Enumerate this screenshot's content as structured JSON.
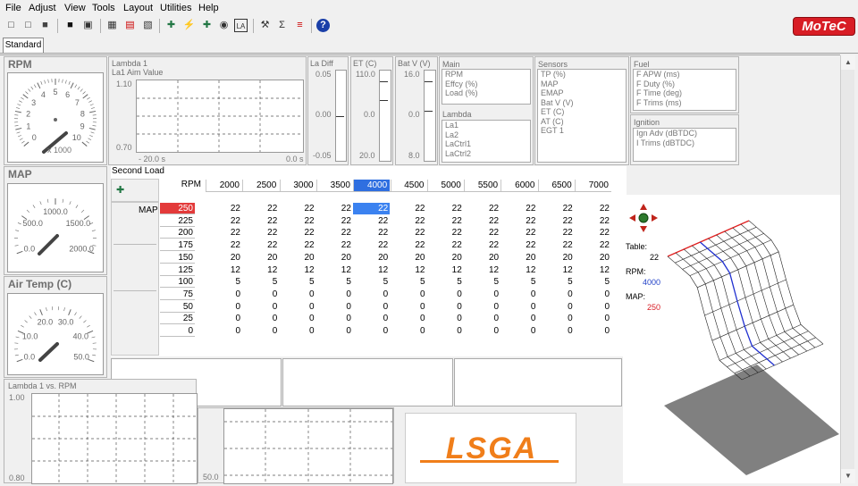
{
  "menu": [
    "File",
    "Adjust",
    "View",
    "Tools",
    "Layout",
    "Utilities",
    "Help"
  ],
  "toolbar_icons": [
    "new-icon",
    "open-icon",
    "folder-icon",
    "save-icon",
    "saveas-icon",
    "table-icon",
    "chart-icon",
    "graph-icon",
    "trend-icon",
    "tune-icon",
    "wand-icon",
    "probe-icon",
    "target-icon",
    "la-icon",
    "wrench-icon",
    "sigma-icon",
    "bars-icon",
    "help-icon"
  ],
  "brand": {
    "logo": "MoTeC",
    "company": "LSGA",
    "accent": "#d81d25",
    "orange": "#f07e1a"
  },
  "tabs": {
    "standard": "Standard"
  },
  "gauges": {
    "rpm": {
      "title": "RPM",
      "ticks": [
        "0",
        "1",
        "2",
        "3",
        "4",
        "5",
        "6",
        "7",
        "8",
        "9",
        "10"
      ],
      "unit": "x 1000",
      "value": 4.0
    },
    "map": {
      "title": "MAP",
      "ticks": [
        "0.0",
        "500.0",
        "1000.0",
        "1500.0",
        "2000.0"
      ],
      "value": 250
    },
    "air": {
      "title": "Air Temp (C)",
      "ticks": [
        "0.0",
        "10.0",
        "20.0",
        "30.0",
        "40.0",
        "50.0"
      ],
      "value": 10
    }
  },
  "lambda_panel": {
    "title1": "Lambda 1",
    "title2": "La1 Aim Value",
    "ymax": "1.10",
    "ymin": "0.70",
    "xleft": "- 20.0 s",
    "xright": "0.0 s"
  },
  "bars": [
    {
      "title": "La Diff",
      "top": "0.05",
      "mid": "0.00",
      "bot": "-0.05"
    },
    {
      "title": "ET (C)",
      "top": "110.0",
      "mid": "0.0",
      "bot": "20.0"
    },
    {
      "title": "Bat V (V)",
      "top": "16.0",
      "mid": "0.0",
      "bot": "8.0"
    }
  ],
  "lists": {
    "main": {
      "title": "Main",
      "items": [
        "RPM",
        "Effcy (%)",
        "Load (%)"
      ]
    },
    "lambda": {
      "title": "Lambda",
      "items": [
        "La1",
        "La2",
        "LaCtrl1",
        "LaCtrl2"
      ]
    },
    "sensors": {
      "title": "Sensors",
      "items": [
        "TP (%)",
        "MAP",
        "EMAP",
        "Bat V (V)",
        "ET (C)",
        "AT (C)",
        "EGT 1"
      ]
    },
    "fuel": {
      "title": "Fuel",
      "items": [
        "F APW (ms)",
        "F Duty (%)",
        "F Time (deg)",
        "F Trims (ms)"
      ]
    },
    "ignition": {
      "title": "Ignition",
      "items": [
        "Ign Adv (dBTDC)",
        "I Trims (dBTDC)"
      ]
    }
  },
  "table": {
    "title": "Second Load",
    "rpm_label": "RPM",
    "map_label": "MAP",
    "rpm": [
      "2000",
      "2500",
      "3000",
      "3500",
      "4000",
      "4500",
      "5000",
      "5500",
      "6000",
      "6500",
      "7000"
    ],
    "map": [
      "250",
      "225",
      "200",
      "175",
      "150",
      "125",
      "100",
      "75",
      "50",
      "25",
      "0"
    ],
    "values": [
      [
        "22",
        "22",
        "22",
        "22",
        "22",
        "22",
        "22",
        "22",
        "22",
        "22",
        "22"
      ],
      [
        "22",
        "22",
        "22",
        "22",
        "22",
        "22",
        "22",
        "22",
        "22",
        "22",
        "22"
      ],
      [
        "22",
        "22",
        "22",
        "22",
        "22",
        "22",
        "22",
        "22",
        "22",
        "22",
        "22"
      ],
      [
        "22",
        "22",
        "22",
        "22",
        "22",
        "22",
        "22",
        "22",
        "22",
        "22",
        "22"
      ],
      [
        "20",
        "20",
        "20",
        "20",
        "20",
        "20",
        "20",
        "20",
        "20",
        "20",
        "20"
      ],
      [
        "12",
        "12",
        "12",
        "12",
        "12",
        "12",
        "12",
        "12",
        "12",
        "12",
        "12"
      ],
      [
        "5",
        "5",
        "5",
        "5",
        "5",
        "5",
        "5",
        "5",
        "5",
        "5",
        "5"
      ],
      [
        "0",
        "0",
        "0",
        "0",
        "0",
        "0",
        "0",
        "0",
        "0",
        "0",
        "0"
      ],
      [
        "0",
        "0",
        "0",
        "0",
        "0",
        "0",
        "0",
        "0",
        "0",
        "0",
        "0"
      ],
      [
        "0",
        "0",
        "0",
        "0",
        "0",
        "0",
        "0",
        "0",
        "0",
        "0",
        "0"
      ],
      [
        "0",
        "0",
        "0",
        "0",
        "0",
        "0",
        "0",
        "0",
        "0",
        "0",
        "0"
      ]
    ],
    "selected_rpm_index": 4,
    "selected_map_index": 0
  },
  "readout": {
    "table_label": "Table:",
    "table_value": "22",
    "rpm_label": "RPM:",
    "rpm_value": "4000",
    "map_label": "MAP:",
    "map_value": "250"
  },
  "bottom_graph": {
    "title": "Lambda 1 vs. RPM",
    "ymax": "1.00",
    "ymin": "0.80"
  },
  "bottom_graph2": {
    "ymin": "50.0"
  }
}
